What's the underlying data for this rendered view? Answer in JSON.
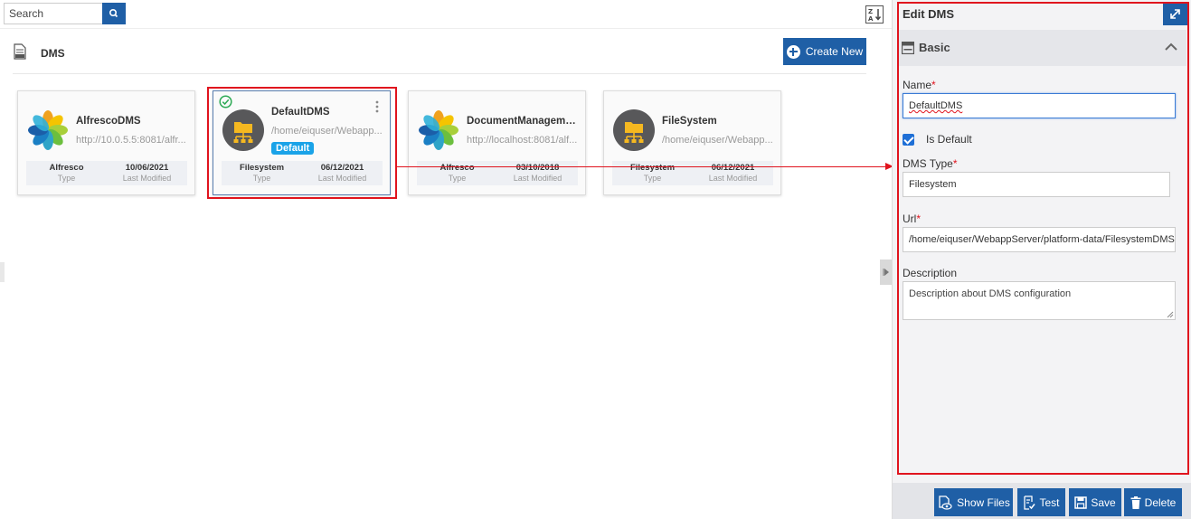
{
  "search": {
    "placeholder": "Search"
  },
  "header": {
    "title": "DMS",
    "create_label": "Create New"
  },
  "cards": [
    {
      "name": "AlfrescoDMS",
      "url": "http://10.0.5.5:8081/alfr...",
      "type": "Alfresco",
      "modified": "10/06/2021",
      "type_label": "Type",
      "modified_label": "Last Modified"
    },
    {
      "name": "DefaultDMS",
      "url": "/home/eiquser/Webapp...",
      "badge": "Default",
      "type": "Filesystem",
      "modified": "06/12/2021",
      "type_label": "Type",
      "modified_label": "Last Modified"
    },
    {
      "name": "DocumentManageme...",
      "url": "http://localhost:8081/alf...",
      "type": "Alfresco",
      "modified": "03/10/2018",
      "type_label": "Type",
      "modified_label": "Last Modified"
    },
    {
      "name": "FileSystem",
      "url": "/home/eiquser/Webapp...",
      "type": "Filesystem",
      "modified": "06/12/2021",
      "type_label": "Type",
      "modified_label": "Last Modified"
    }
  ],
  "panel": {
    "title": "Edit DMS",
    "section": "Basic",
    "name_label": "Name",
    "name_value": "DefaultDMS",
    "is_default_label": "Is Default",
    "dms_type_label": "DMS Type",
    "dms_type_value": "Filesystem",
    "url_label": "Url",
    "url_value": "/home/eiquser/WebappServer/platform-data/FilesystemDMS/",
    "description_label": "Description",
    "description_value": "Description about DMS configuration",
    "required_mark": "*"
  },
  "footer": {
    "show_files": "Show Files",
    "test": "Test",
    "save": "Save",
    "delete": "Delete"
  },
  "colors": {
    "accent": "#1f5fa6",
    "highlight": "#e0141e",
    "badge": "#1aa3e8"
  }
}
